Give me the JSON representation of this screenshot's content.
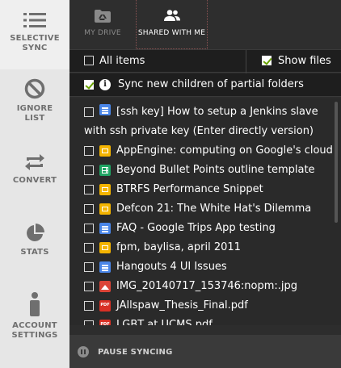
{
  "sidebar": {
    "items": [
      {
        "id": "selective-sync",
        "label_1": "SELECTIVE",
        "label_2": "SYNC",
        "icon": "list-icon",
        "active": true
      },
      {
        "id": "ignore-list",
        "label_1": "IGNORE",
        "label_2": "LIST",
        "icon": "block-icon",
        "active": false
      },
      {
        "id": "convert",
        "label_1": "CONVERT",
        "label_2": "",
        "icon": "convert-icon",
        "active": false
      },
      {
        "id": "stats",
        "label_1": "STATS",
        "label_2": "",
        "icon": "pie-chart-icon",
        "active": false
      },
      {
        "id": "account-settings",
        "label_1": "ACCOUNT",
        "label_2": "SETTINGS",
        "icon": "person-icon",
        "active": false
      }
    ]
  },
  "tabs": {
    "my_drive": "MY DRIVE",
    "shared_with_me": "SHARED WITH ME",
    "active": "shared_with_me"
  },
  "controls": {
    "all_items": {
      "label": "All items",
      "checked": false
    },
    "show_files": {
      "label": "Show files",
      "checked": true
    },
    "sync_new_children": {
      "label": "Sync new children of partial folders",
      "checked": true
    }
  },
  "files": [
    {
      "name": "[ssh key] How to setup a Jenkins slave",
      "name_2": "with ssh private key (Enter directly version)",
      "type": "doc",
      "checked": false
    },
    {
      "name": "AppEngine: computing on Google's cloud",
      "type": "slides",
      "checked": false
    },
    {
      "name": "Beyond Bullet Points outline template",
      "type": "sheet",
      "checked": false
    },
    {
      "name": "BTRFS Performance Snippet",
      "type": "slides",
      "checked": false
    },
    {
      "name": "Defcon 21: The White Hat's Dilemma",
      "type": "slides",
      "checked": false
    },
    {
      "name": "FAQ - Google Trips App testing",
      "type": "doc",
      "checked": false
    },
    {
      "name": "fpm, baylisa, april 2011",
      "type": "slides",
      "checked": false
    },
    {
      "name": "Hangouts 4 UI Issues",
      "type": "doc",
      "checked": false
    },
    {
      "name": "IMG_20140717_153746:nopm:.jpg",
      "type": "image",
      "checked": false
    },
    {
      "name": "JAllspaw_Thesis_Final.pdf",
      "type": "pdf",
      "checked": false
    },
    {
      "name": "LGBT at UCMS.pdf",
      "type": "pdf",
      "checked": false
    }
  ],
  "footer": {
    "pause_label": "PAUSE SYNCING"
  },
  "colors": {
    "check_green": "#6aa300",
    "doc_blue": "#4a86e8",
    "slides_yellow": "#f4b400",
    "sheet_green": "#1fa463",
    "image_red": "#db4437",
    "pdf_red": "#d93025"
  }
}
